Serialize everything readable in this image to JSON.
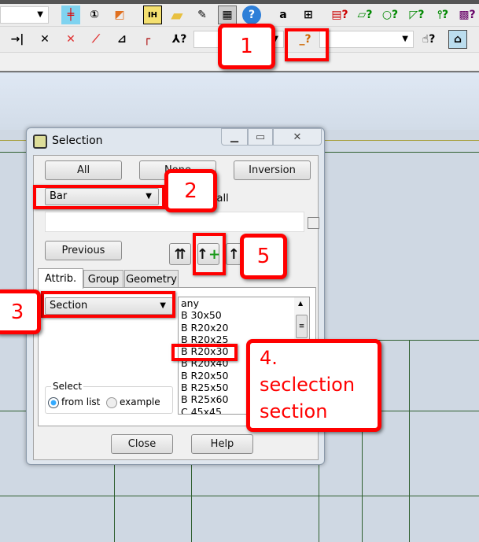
{
  "toolbar": {
    "row1_icons": [
      "grid-icon",
      "numbering-icon",
      "dimension-icon",
      "table-icon",
      "folder-icon",
      "notepad-icon",
      "calculator-icon",
      "help-icon",
      "text-colors-icon",
      "legend-icon",
      "color-query-icon",
      "panel-query-icon",
      "circle-query-icon",
      "polygon-query-icon",
      "node-query-icon",
      "solid-query-icon"
    ],
    "row2_icons": [
      "frame-icon",
      "extend-icon",
      "intersect-icon",
      "trim-icon",
      "break-icon",
      "fillet-icon",
      "corner-icon",
      "node-select-icon",
      "bar-select-icon",
      "hand-query-icon",
      "window-icon"
    ]
  },
  "dialog": {
    "title": "Selection",
    "buttons": {
      "all": "All",
      "none": "None",
      "inversion": "Inversion",
      "previous": "Previous",
      "close": "Close",
      "help": "Help"
    },
    "object_type": "Bar",
    "notify_label": "Notify all",
    "selection_text": "",
    "tabs": [
      "Attrib.",
      "Group",
      "Geometry"
    ],
    "active_tab": "Attrib.",
    "attribute": "Section",
    "list_items": [
      "any",
      "B 30x50",
      "B R20x20",
      "B R20x25",
      "B R20x30",
      "B R20x40",
      "B R20x50",
      "B R25x50",
      "B R25x60",
      "C 45x45"
    ],
    "selected_item": "B R20x30",
    "select_group": {
      "label": "Select",
      "from_list": "from list",
      "example": "example",
      "value": "from list"
    }
  },
  "annotations": {
    "a1": "1",
    "a2": "2",
    "a3": "3",
    "a4_line1": "4.",
    "a4_line2": "seclection",
    "a4_line3": "section",
    "a5": "5"
  },
  "colors": {
    "annotation": "#ff0000",
    "grid": "#2f5f2f"
  }
}
